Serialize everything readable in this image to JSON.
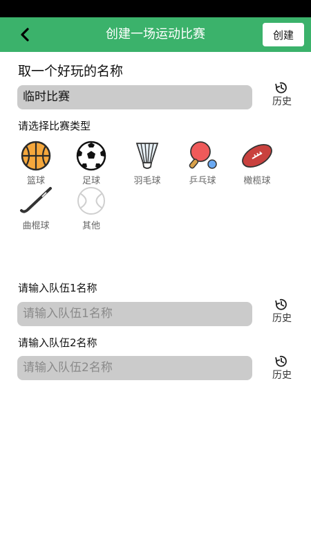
{
  "header": {
    "title": "创建一场运动比赛",
    "create_label": "创建"
  },
  "name_section": {
    "title": "取一个好玩的名称",
    "value": "临时比赛",
    "history_label": "历史"
  },
  "type_section": {
    "title": "请选择比赛类型",
    "sports": [
      {
        "label": "篮球",
        "icon": "basketball-icon"
      },
      {
        "label": "足球",
        "icon": "soccer-ball-icon"
      },
      {
        "label": "羽毛球",
        "icon": "shuttlecock-icon"
      },
      {
        "label": "乒乓球",
        "icon": "ping-pong-icon"
      },
      {
        "label": "橄榄球",
        "icon": "rugby-ball-icon"
      },
      {
        "label": "曲棍球",
        "icon": "hockey-stick-icon"
      },
      {
        "label": "其他",
        "icon": "other-ball-icon"
      }
    ]
  },
  "team1": {
    "label": "请输入队伍1名称",
    "placeholder": "请输入队伍1名称",
    "history_label": "历史"
  },
  "team2": {
    "label": "请输入队伍2名称",
    "placeholder": "请输入队伍2名称",
    "history_label": "历史"
  },
  "colors": {
    "appbar": "#3bb26b",
    "input_bg": "#cbcbcb"
  }
}
